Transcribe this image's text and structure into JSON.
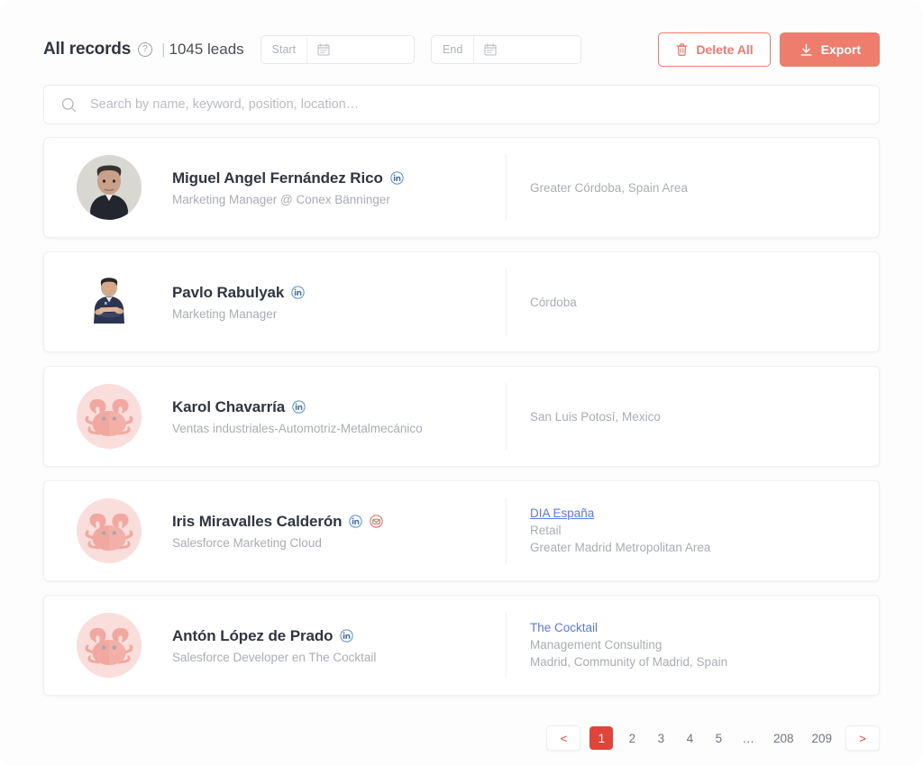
{
  "header": {
    "title": "All records",
    "help_icon": "question-circle-icon",
    "separator": "|",
    "lead_count": "1045 leads",
    "start_date": {
      "label": "Start",
      "value": "",
      "icon": "calendar-icon"
    },
    "end_date": {
      "label": "End",
      "value": "",
      "icon": "calendar-icon"
    },
    "delete_all_label": "Delete All",
    "delete_all_icon": "trash-icon",
    "export_label": "Export",
    "export_icon": "download-icon"
  },
  "search": {
    "placeholder": "Search by name, keyword, position, location…",
    "value": "",
    "icon": "search-icon"
  },
  "colors": {
    "accent": "#ee7d6e",
    "accent_border": "#ef7a6d",
    "pagination_active": "#e0443a",
    "link": "#5b79e8",
    "linkedin": "#4a7ec4",
    "email_icon": "#e0695e",
    "avatar_bg": "#fae0dd",
    "crab": "#f1a8a0",
    "text_primary": "#2f3640",
    "text_muted": "#a9adb3"
  },
  "leads": [
    {
      "name": "Miguel Angel Fernández Rico",
      "position": "Marketing Manager @ Conex Bänninger",
      "avatar_type": "photo-man-grey-bg",
      "badges": [
        "linkedin-icon"
      ],
      "company_link": "",
      "company_lines": [
        "Greater Córdoba, Spain Area"
      ],
      "link_underlined": false
    },
    {
      "name": "Pavlo Rabulyak",
      "position": "Marketing Manager",
      "avatar_type": "photo-man-white-bg",
      "badges": [
        "linkedin-icon"
      ],
      "company_link": "",
      "company_lines": [
        "Córdoba"
      ],
      "link_underlined": false
    },
    {
      "name": "Karol Chavarría",
      "position": "Ventas industriales-Automotriz-Metalmecánico",
      "avatar_type": "crab-placeholder",
      "badges": [
        "linkedin-icon"
      ],
      "company_link": "",
      "company_lines": [
        "San Luis Potosí, Mexico"
      ],
      "link_underlined": false
    },
    {
      "name": "Iris Miravalles Calderón",
      "position": "Salesforce Marketing Cloud",
      "avatar_type": "crab-placeholder",
      "badges": [
        "linkedin-icon",
        "email-icon"
      ],
      "company_link": "DIA España",
      "company_lines": [
        "Retail",
        "Greater Madrid Metropolitan Area"
      ],
      "link_underlined": true
    },
    {
      "name": "Antón López de Prado",
      "position": "Salesforce Developer en The Cocktail",
      "avatar_type": "crab-placeholder",
      "badges": [
        "linkedin-icon"
      ],
      "company_link": "The Cocktail",
      "company_lines": [
        "Management Consulting",
        "Madrid, Community of Madrid, Spain"
      ],
      "link_underlined": false
    }
  ],
  "pagination": {
    "prev": "<",
    "next": ">",
    "pages": [
      "1",
      "2",
      "3",
      "4",
      "5",
      "…",
      "208",
      "209"
    ],
    "active": "1"
  }
}
